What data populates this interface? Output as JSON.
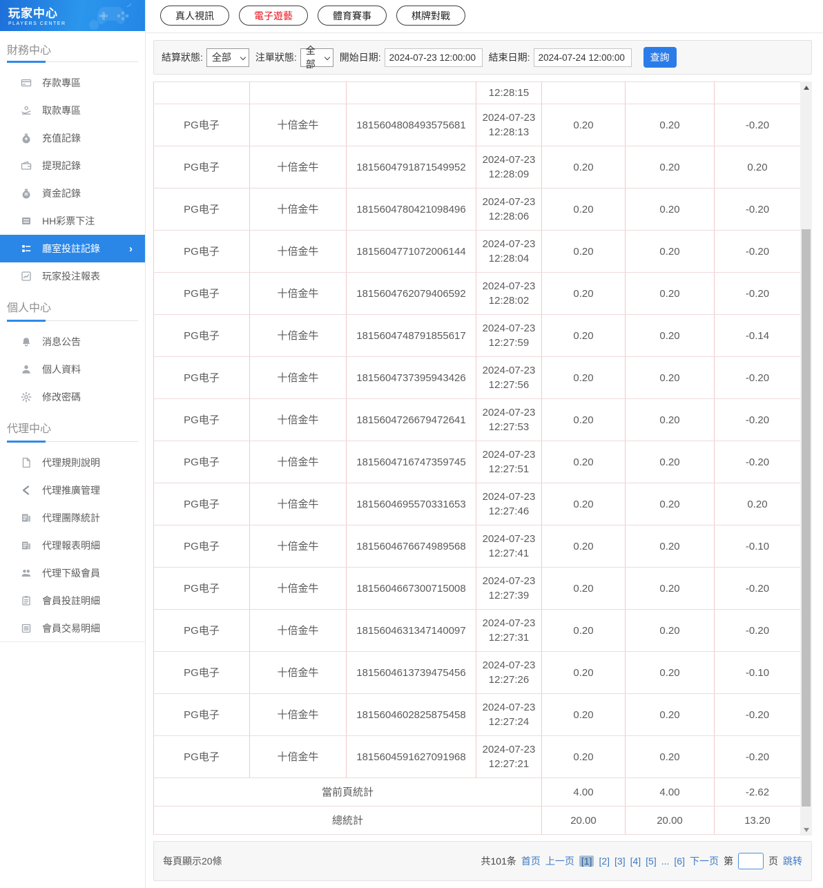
{
  "logo": {
    "title": "玩家中心",
    "subtitle": "PLAYERS CENTER"
  },
  "sidebar": {
    "sections": [
      {
        "title": "財務中心",
        "items": [
          {
            "label": "存款專區",
            "icon": "deposit-card-icon"
          },
          {
            "label": "取款專區",
            "icon": "withdraw-hand-icon"
          },
          {
            "label": "充值記錄",
            "icon": "recharge-moneybag-icon"
          },
          {
            "label": "提現記錄",
            "icon": "withdraw-wallet-icon"
          },
          {
            "label": "資金記錄",
            "icon": "funds-moneybag-icon"
          },
          {
            "label": "HH彩票下注",
            "icon": "lottery-list-icon"
          },
          {
            "label": "廳室投註記錄",
            "icon": "room-bet-record-icon",
            "active": true,
            "chevron": "›"
          },
          {
            "label": "玩家投注報表",
            "icon": "player-report-chart-icon"
          }
        ]
      },
      {
        "title": "個人中心",
        "items": [
          {
            "label": "消息公告",
            "icon": "bell-icon"
          },
          {
            "label": "個人資料",
            "icon": "person-icon"
          },
          {
            "label": "修改密碼",
            "icon": "gear-icon"
          }
        ]
      },
      {
        "title": "代理中心",
        "items": [
          {
            "label": "代理規則說明",
            "icon": "document-icon"
          },
          {
            "label": "代理推廣管理",
            "icon": "share-icon"
          },
          {
            "label": "代理團隊統計",
            "icon": "report-icon"
          },
          {
            "label": "代理報表明細",
            "icon": "report-icon"
          },
          {
            "label": "代理下級會員",
            "icon": "users-icon"
          },
          {
            "label": "會員投註明細",
            "icon": "clipboard-icon"
          },
          {
            "label": "會員交易明細",
            "icon": "clipboard-lines-icon"
          }
        ]
      }
    ]
  },
  "tabs": [
    {
      "label": "真人視訊",
      "active": false
    },
    {
      "label": "電子遊藝",
      "active": true
    },
    {
      "label": "體育賽事",
      "active": false
    },
    {
      "label": "棋牌對戰",
      "active": false
    }
  ],
  "filters": {
    "settle_status_label": "結算狀態:",
    "settle_status_value": "全部",
    "order_status_label": "注單狀態:",
    "order_status_value": "全部",
    "start_date_label": "開始日期:",
    "start_date_value": "2024-07-23 12:00:00",
    "end_date_label": "結束日期:",
    "end_date_value": "2024-07-24 12:00:00",
    "query_button": "查詢"
  },
  "table": {
    "partial_row_time": "12:28:15",
    "rows": [
      [
        "PG电子",
        "十倍金牛",
        "1815604808493575681",
        "2024-07-23",
        "12:28:13",
        "0.20",
        "0.20",
        "-0.20"
      ],
      [
        "PG电子",
        "十倍金牛",
        "1815604791871549952",
        "2024-07-23",
        "12:28:09",
        "0.20",
        "0.20",
        "0.20"
      ],
      [
        "PG电子",
        "十倍金牛",
        "1815604780421098496",
        "2024-07-23",
        "12:28:06",
        "0.20",
        "0.20",
        "-0.20"
      ],
      [
        "PG电子",
        "十倍金牛",
        "1815604771072006144",
        "2024-07-23",
        "12:28:04",
        "0.20",
        "0.20",
        "-0.20"
      ],
      [
        "PG电子",
        "十倍金牛",
        "1815604762079406592",
        "2024-07-23",
        "12:28:02",
        "0.20",
        "0.20",
        "-0.20"
      ],
      [
        "PG电子",
        "十倍金牛",
        "1815604748791855617",
        "2024-07-23",
        "12:27:59",
        "0.20",
        "0.20",
        "-0.14"
      ],
      [
        "PG电子",
        "十倍金牛",
        "1815604737395943426",
        "2024-07-23",
        "12:27:56",
        "0.20",
        "0.20",
        "-0.20"
      ],
      [
        "PG电子",
        "十倍金牛",
        "1815604726679472641",
        "2024-07-23",
        "12:27:53",
        "0.20",
        "0.20",
        "-0.20"
      ],
      [
        "PG电子",
        "十倍金牛",
        "1815604716747359745",
        "2024-07-23",
        "12:27:51",
        "0.20",
        "0.20",
        "-0.20"
      ],
      [
        "PG电子",
        "十倍金牛",
        "1815604695570331653",
        "2024-07-23",
        "12:27:46",
        "0.20",
        "0.20",
        "0.20"
      ],
      [
        "PG电子",
        "十倍金牛",
        "1815604676674989568",
        "2024-07-23",
        "12:27:41",
        "0.20",
        "0.20",
        "-0.10"
      ],
      [
        "PG电子",
        "十倍金牛",
        "1815604667300715008",
        "2024-07-23",
        "12:27:39",
        "0.20",
        "0.20",
        "-0.20"
      ],
      [
        "PG电子",
        "十倍金牛",
        "1815604631347140097",
        "2024-07-23",
        "12:27:31",
        "0.20",
        "0.20",
        "-0.20"
      ],
      [
        "PG电子",
        "十倍金牛",
        "1815604613739475456",
        "2024-07-23",
        "12:27:26",
        "0.20",
        "0.20",
        "-0.10"
      ],
      [
        "PG电子",
        "十倍金牛",
        "1815604602825875458",
        "2024-07-23",
        "12:27:24",
        "0.20",
        "0.20",
        "-0.20"
      ],
      [
        "PG电子",
        "十倍金牛",
        "1815604591627091968",
        "2024-07-23",
        "12:27:21",
        "0.20",
        "0.20",
        "-0.20"
      ]
    ],
    "page_summary": {
      "label": "當前頁統計",
      "bet": "4.00",
      "valid": "4.00",
      "winloss": "-2.62"
    },
    "total_summary": {
      "label": "總統計",
      "bet": "20.00",
      "valid": "20.00",
      "winloss": "13.20"
    }
  },
  "footer": {
    "per_page_text": "每頁顯示20條",
    "total_text": "共101条",
    "first_label": "首页",
    "prev_label": "上一页",
    "pages": [
      "[1]",
      "[2]",
      "[3]",
      "[4]",
      "[5]"
    ],
    "ellipsis": "...",
    "page6": "[6]",
    "next_label": "下一页",
    "jump_prefix": "第",
    "jump_suffix": "页",
    "jump_label": "跳转",
    "jump_value": ""
  },
  "colors": {
    "accent_blue": "#2a87e8",
    "active_tab_red": "#e8101c",
    "query_button_blue": "#2b7ce9",
    "link_blue": "#3e79c4",
    "current_page_bg": "#a9bfd3",
    "table_border_pink": "#f1c9c9"
  }
}
